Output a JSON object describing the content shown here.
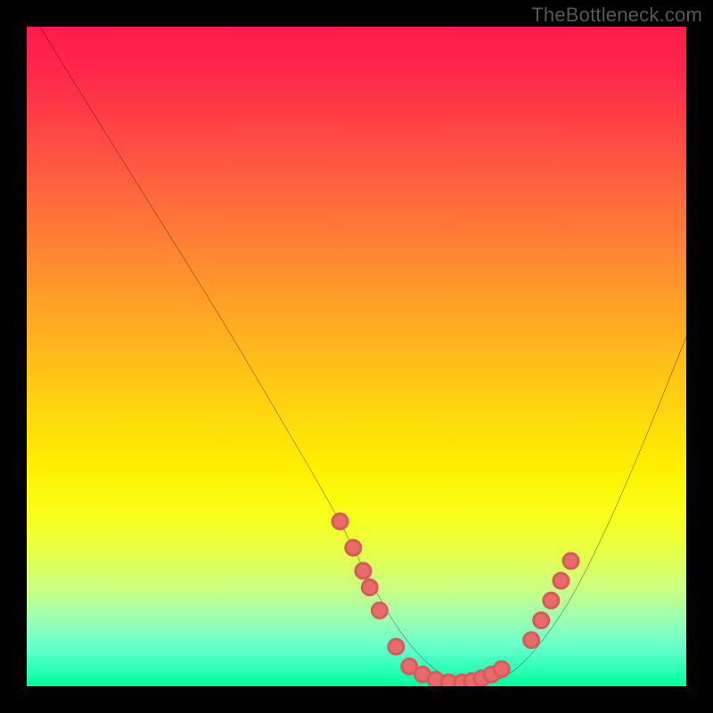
{
  "watermark": "TheBottleneck.com",
  "chart_data": {
    "type": "line",
    "title": "",
    "xlabel": "",
    "ylabel": "",
    "xlim": [
      0,
      100
    ],
    "ylim": [
      0,
      100
    ],
    "curve": {
      "name": "bottleneck-curve",
      "x": [
        2,
        10,
        20,
        30,
        40,
        47,
        52,
        56,
        60,
        64,
        68,
        72,
        76,
        82,
        88,
        94,
        100
      ],
      "y": [
        100,
        87,
        71,
        55,
        38,
        26,
        16,
        9,
        4,
        1,
        0,
        1,
        4,
        12,
        24,
        38,
        53
      ]
    },
    "markers": {
      "name": "highlight-dots",
      "points": [
        {
          "x": 47.5,
          "y": 25
        },
        {
          "x": 49.5,
          "y": 21
        },
        {
          "x": 51,
          "y": 17.5
        },
        {
          "x": 52,
          "y": 15
        },
        {
          "x": 53.5,
          "y": 11.5
        },
        {
          "x": 56,
          "y": 6
        },
        {
          "x": 58,
          "y": 3
        },
        {
          "x": 60,
          "y": 1.8
        },
        {
          "x": 62,
          "y": 1
        },
        {
          "x": 64,
          "y": 0.6
        },
        {
          "x": 66,
          "y": 0.6
        },
        {
          "x": 67.5,
          "y": 0.8
        },
        {
          "x": 69,
          "y": 1.2
        },
        {
          "x": 70.5,
          "y": 1.8
        },
        {
          "x": 72,
          "y": 2.6
        },
        {
          "x": 76.5,
          "y": 7
        },
        {
          "x": 78,
          "y": 10
        },
        {
          "x": 79.5,
          "y": 13
        },
        {
          "x": 81,
          "y": 16
        },
        {
          "x": 82.5,
          "y": 19
        }
      ]
    }
  }
}
